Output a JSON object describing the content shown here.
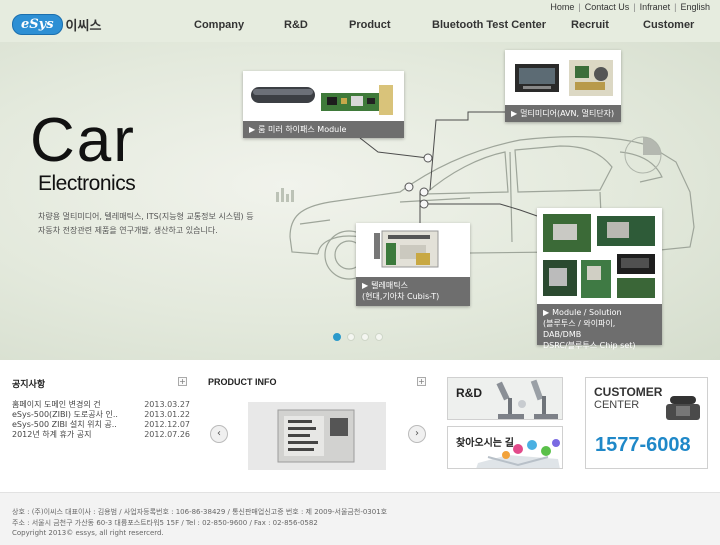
{
  "logo": {
    "brand": "eSys",
    "korean": "이씨스"
  },
  "util_links": [
    "Home",
    "Contact Us",
    "Infranet",
    "English"
  ],
  "nav": [
    "Company",
    "R&D",
    "Product",
    "Bluetooth Test Center",
    "Recruit",
    "Customer"
  ],
  "hero": {
    "title": "Car",
    "subtitle": "Electronics",
    "desc_line1": "차량용 멀티미디어, 텔레매틱스, ITS(지능형 교통정보 시스템) 등",
    "desc_line2": "자동차 전장관련 제품을 연구개발, 생산하고 있습니다.",
    "products": {
      "mirror": "룸 미러 하이패스 Module",
      "multimedia": "멀티미디어(AVN, 멀티단자)",
      "telematics_1": "텔레매틱스",
      "telematics_2": "(현대,기아차 Cubis-T)",
      "module_1": "Module / Solution",
      "module_2": "(블루투스 / 와이파이, DAB/DMB",
      "module_3": "DSRC/블루투스 Chip set)"
    },
    "slide_count": 4,
    "active_slide": 1
  },
  "notice": {
    "title": "공지사항",
    "items": [
      {
        "text": "홈페이지 도메인 변경의 건",
        "date": "2013.03.27"
      },
      {
        "text": "eSys-500(ZIBI) 도로공사 인..",
        "date": "2013.01.22"
      },
      {
        "text": "eSys-500 ZIBI 설치 위치 공..",
        "date": "2012.12.07"
      },
      {
        "text": "2012년 하계 휴가 공지",
        "date": "2012.07.26"
      }
    ]
  },
  "product_info": {
    "title": "PRODUCT INFO"
  },
  "rnd_banner": {
    "label": "R&D"
  },
  "map_banner": {
    "label": "찾아오시는 길"
  },
  "customer": {
    "line1": "CUSTOMER",
    "line2": "CENTER",
    "phone": "1577-6008"
  },
  "footer": {
    "line1": "상호 : (주)이씨스 대표이사 : 김용범 / 사업자등록번호 : 106-86-38429 / 통신판매업신고증 번호 : 제 2009-서울금천-0301호",
    "line2": "주소 : 서울시 금천구 가산동 60-3 대륭포스트타워5 15F / Tel : 02-850-9600 / Fax : 02-856-0582",
    "line3": "Copyright 2013© essys, all right resercerd."
  },
  "colors": {
    "accent": "#2b9acb",
    "phone": "#1f88c8",
    "caption": "#6e6e6e"
  }
}
